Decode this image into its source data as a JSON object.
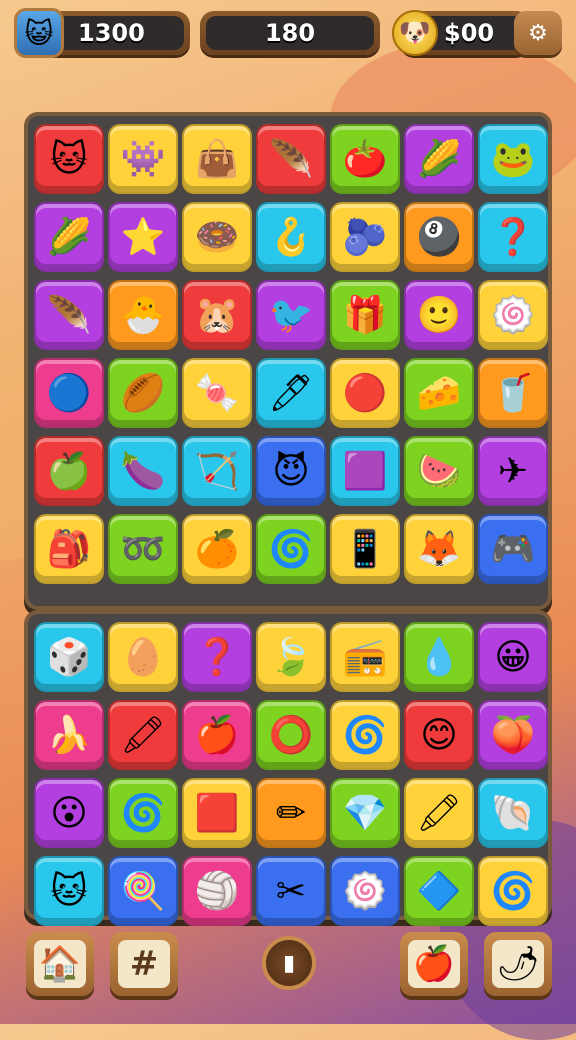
{
  "hud": {
    "player_score": "1300",
    "moves": "180",
    "coins": "$00",
    "avatar_icon": "😺",
    "coin_icon": "🐶",
    "settings_icon": "⚙"
  },
  "colors": {
    "red": "#ef3b3b",
    "yellow": "#ffd23a",
    "green": "#7ed321",
    "purple": "#b43fe0",
    "cyan": "#29c7ec",
    "orange": "#ff9a1f",
    "blue": "#3a6ff0",
    "pink": "#ee3c8f"
  },
  "top_board": [
    [
      {
        "c": "red",
        "i": "🐱",
        "n": "cat-face-icon"
      },
      {
        "c": "yellow",
        "i": "👾",
        "n": "purple-monster-icon"
      },
      {
        "c": "yellow",
        "i": "👜",
        "n": "purple-bag-icon"
      },
      {
        "c": "red",
        "i": "🪶",
        "n": "blue-leaf-icon"
      },
      {
        "c": "green",
        "i": "🍅",
        "n": "tomato-icon"
      },
      {
        "c": "purple",
        "i": "🌽",
        "n": "corn-icon"
      },
      {
        "c": "cyan",
        "i": "🐸",
        "n": "frog-icon"
      }
    ],
    [
      {
        "c": "purple",
        "i": "🌽",
        "n": "corn-icon"
      },
      {
        "c": "purple",
        "i": "⭐",
        "n": "star-icon"
      },
      {
        "c": "yellow",
        "i": "🍩",
        "n": "ring-icon"
      },
      {
        "c": "cyan",
        "i": "🪝",
        "n": "hook-icon"
      },
      {
        "c": "yellow",
        "i": "🫐",
        "n": "purple-ball-icon"
      },
      {
        "c": "orange",
        "i": "🎱",
        "n": "striped-ball-icon"
      },
      {
        "c": "cyan",
        "i": "❓",
        "n": "question-icon"
      }
    ],
    [
      {
        "c": "purple",
        "i": "🪶",
        "n": "cyan-leaf-icon"
      },
      {
        "c": "orange",
        "i": "🐣",
        "n": "white-face-icon"
      },
      {
        "c": "red",
        "i": "🐹",
        "n": "hamster-icon"
      },
      {
        "c": "purple",
        "i": "🐦",
        "n": "blue-bird-icon"
      },
      {
        "c": "green",
        "i": "🎁",
        "n": "box-icon"
      },
      {
        "c": "purple",
        "i": "🙂",
        "n": "blue-face-icon"
      },
      {
        "c": "yellow",
        "i": "🍥",
        "n": "swirl-icon"
      }
    ],
    [
      {
        "c": "pink",
        "i": "🔵",
        "n": "blue-ball-icon"
      },
      {
        "c": "green",
        "i": "🏉",
        "n": "ball-icon"
      },
      {
        "c": "yellow",
        "i": "🍬",
        "n": "candy-icon"
      },
      {
        "c": "cyan",
        "i": "🖊",
        "n": "pen-icon"
      },
      {
        "c": "yellow",
        "i": "🔴",
        "n": "red-star-ball-icon"
      },
      {
        "c": "green",
        "i": "🧀",
        "n": "cheese-icon"
      },
      {
        "c": "orange",
        "i": "🥤",
        "n": "cup-icon"
      }
    ],
    [
      {
        "c": "red",
        "i": "🍏",
        "n": "green-apple-icon"
      },
      {
        "c": "cyan",
        "i": "🍆",
        "n": "purple-fruit-icon"
      },
      {
        "c": "cyan",
        "i": "🏹",
        "n": "arrow-icon"
      },
      {
        "c": "blue",
        "i": "😈",
        "n": "purple-creature-icon"
      },
      {
        "c": "cyan",
        "i": "🟪",
        "n": "square-gem-icon"
      },
      {
        "c": "green",
        "i": "🍉",
        "n": "watermelon-icon"
      },
      {
        "c": "purple",
        "i": "✈",
        "n": "paper-plane-icon"
      }
    ],
    [
      {
        "c": "yellow",
        "i": "🎒",
        "n": "backpack-icon"
      },
      {
        "c": "green",
        "i": "➿",
        "n": "loop-icon"
      },
      {
        "c": "yellow",
        "i": "🍊",
        "n": "orange-fruit-icon"
      },
      {
        "c": "green",
        "i": "🌀",
        "n": "spiral-icon"
      },
      {
        "c": "yellow",
        "i": "📱",
        "n": "calculator-icon"
      },
      {
        "c": "yellow",
        "i": "🦊",
        "n": "fox-icon"
      },
      {
        "c": "blue",
        "i": "🎮",
        "n": "gameboy-icon"
      }
    ]
  ],
  "bottom_board": [
    [
      {
        "c": "cyan",
        "i": "🎲",
        "n": "trinket-icon"
      },
      {
        "c": "yellow",
        "i": "🥚",
        "n": "red-egg-icon"
      },
      {
        "c": "purple",
        "i": "❓",
        "n": "question-icon"
      },
      {
        "c": "yellow",
        "i": "🍃",
        "n": "green-leaf-icon"
      },
      {
        "c": "yellow",
        "i": "📻",
        "n": "radio-icon"
      },
      {
        "c": "green",
        "i": "💧",
        "n": "drop-icon"
      },
      {
        "c": "purple",
        "i": "😀",
        "n": "orange-face-icon"
      }
    ],
    [
      {
        "c": "pink",
        "i": "🍌",
        "n": "banana-icon"
      },
      {
        "c": "red",
        "i": "🖍",
        "n": "crayon-icon"
      },
      {
        "c": "pink",
        "i": "🍎",
        "n": "apple-icon"
      },
      {
        "c": "green",
        "i": "⭕",
        "n": "grey-ring-icon"
      },
      {
        "c": "yellow",
        "i": "🌀",
        "n": "cyan-swirl-icon"
      },
      {
        "c": "red",
        "i": "😊",
        "n": "smile-face-icon"
      },
      {
        "c": "purple",
        "i": "🍑",
        "n": "peach-icon"
      }
    ],
    [
      {
        "c": "purple",
        "i": "😮",
        "n": "surprised-face-icon"
      },
      {
        "c": "green",
        "i": "🌀",
        "n": "blue-spiral-icon"
      },
      {
        "c": "yellow",
        "i": "🟥",
        "n": "red-square-icon"
      },
      {
        "c": "orange",
        "i": "✏",
        "n": "pencil-icon"
      },
      {
        "c": "green",
        "i": "💎",
        "n": "gem-icon"
      },
      {
        "c": "yellow",
        "i": "🖍",
        "n": "red-crayon-icon"
      },
      {
        "c": "cyan",
        "i": "🐚",
        "n": "shell-icon"
      }
    ],
    [
      {
        "c": "cyan",
        "i": "🐱",
        "n": "white-cat-icon"
      },
      {
        "c": "blue",
        "i": "🍭",
        "n": "lollipop-icon"
      },
      {
        "c": "pink",
        "i": "🏐",
        "n": "beach-ball-icon"
      },
      {
        "c": "blue",
        "i": "✂",
        "n": "tools-icon"
      },
      {
        "c": "blue",
        "i": "🍥",
        "n": "swirl-candy-icon"
      },
      {
        "c": "green",
        "i": "🔷",
        "n": "blue-gem-icon"
      },
      {
        "c": "yellow",
        "i": "🌀",
        "n": "purple-swirl-icon"
      }
    ]
  ],
  "bottom_nav": {
    "home_icon": "🏠",
    "grid_icon": "#",
    "play_icon": "▮",
    "apple_icon": "🍎",
    "pepper_icon": "🌶"
  }
}
